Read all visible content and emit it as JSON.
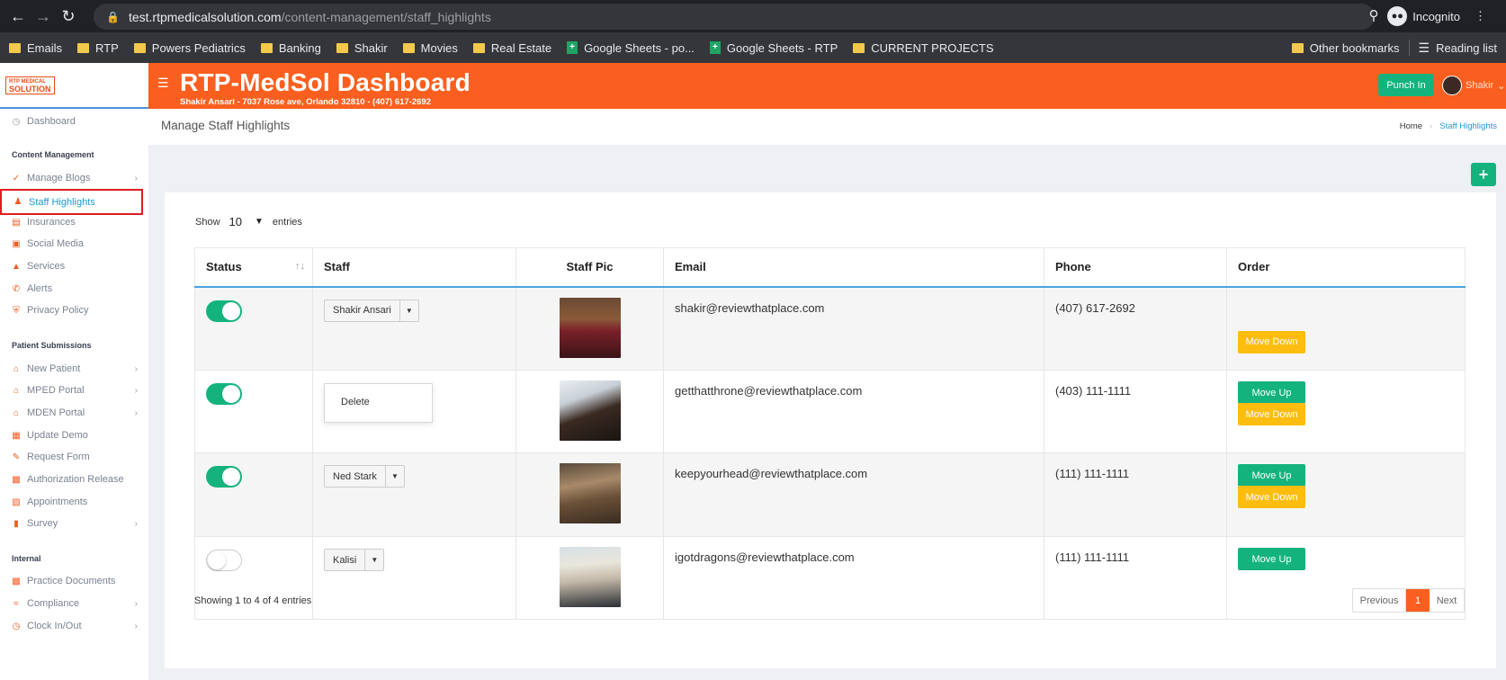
{
  "browser": {
    "url_host": "test.rtpmedicalsolution.com",
    "url_path": "/content-management/staff_highlights",
    "incognito_label": "Incognito",
    "bookmarks": [
      {
        "label": "Emails",
        "type": "folder"
      },
      {
        "label": "RTP",
        "type": "folder"
      },
      {
        "label": "Powers Pediatrics",
        "type": "folder"
      },
      {
        "label": "Banking",
        "type": "folder"
      },
      {
        "label": "Shakir",
        "type": "folder"
      },
      {
        "label": "Movies",
        "type": "folder"
      },
      {
        "label": "Real Estate",
        "type": "folder"
      },
      {
        "label": "Google Sheets - po...",
        "type": "sheet"
      },
      {
        "label": "Google Sheets - RTP",
        "type": "sheet"
      },
      {
        "label": "CURRENT PROJECTS",
        "type": "folder"
      }
    ],
    "other_bookmarks": "Other bookmarks",
    "reading_list": "Reading list"
  },
  "header": {
    "logo_line1": "RTP MEDICAL",
    "logo_line2": "SOLUTION",
    "title": "RTP-MedSol Dashboard",
    "subtitle": "Shakir Ansari - 7037 Rose ave, Orlando 32810 - (407) 617-2692",
    "punch_in": "Punch In",
    "user_name": "Shakir"
  },
  "sidebar": {
    "dashboard": "Dashboard",
    "section_content": "Content Management",
    "section_patient": "Patient Submissions",
    "section_internal": "Internal",
    "items": {
      "manage_blogs": "Manage Blogs",
      "staff_highlights": "Staff Highlights",
      "insurances": "Insurances",
      "social_media": "Social Media",
      "services": "Services",
      "alerts": "Alerts",
      "privacy_policy": "Privacy Policy",
      "new_patient": "New Patient",
      "mped_portal": "MPED Portal",
      "mden_portal": "MDEN Portal",
      "update_demo": "Update Demo",
      "request_form": "Request Form",
      "authorization_release": "Authorization Release",
      "appointments": "Appointments",
      "survey": "Survey",
      "practice_documents": "Practice Documents",
      "compliance": "Compliance",
      "clock_in_out": "Clock In/Out"
    }
  },
  "page": {
    "title": "Manage Staff Highlights",
    "breadcrumb_home": "Home",
    "breadcrumb_current": "Staff Highlights",
    "add_label": "+",
    "show_label": "Show",
    "entries_value": "10",
    "entries_label": "entries",
    "info": "Showing 1 to 4 of 4 entries",
    "prev": "Previous",
    "page_num": "1",
    "next": "Next"
  },
  "table": {
    "headers": {
      "status": "Status",
      "staff": "Staff",
      "pic": "Staff Pic",
      "email": "Email",
      "phone": "Phone",
      "order": "Order"
    },
    "move_up": "Move Up",
    "move_down": "Move Down",
    "dropdown_delete": "Delete",
    "rows": [
      {
        "status": true,
        "staff": "Shakir Ansari",
        "email": "shakir@reviewthatplace.com",
        "phone": "(407) 617-2692"
      },
      {
        "status": true,
        "staff": "",
        "email": "getthatthrone@reviewthatplace.com",
        "phone": "(403) 111-1111"
      },
      {
        "status": true,
        "staff": "Ned Stark",
        "email": "keepyourhead@reviewthatplace.com",
        "phone": "(111) 111-1111"
      },
      {
        "status": false,
        "staff": "Kalisi",
        "email": "igotdragons@reviewthatplace.com",
        "phone": "(111) 111-1111"
      }
    ]
  },
  "colors": {
    "brand_orange": "#fb5f1f",
    "green": "#14b37e",
    "yellow": "#fcbd0e",
    "link_blue": "#1a9ad6"
  }
}
